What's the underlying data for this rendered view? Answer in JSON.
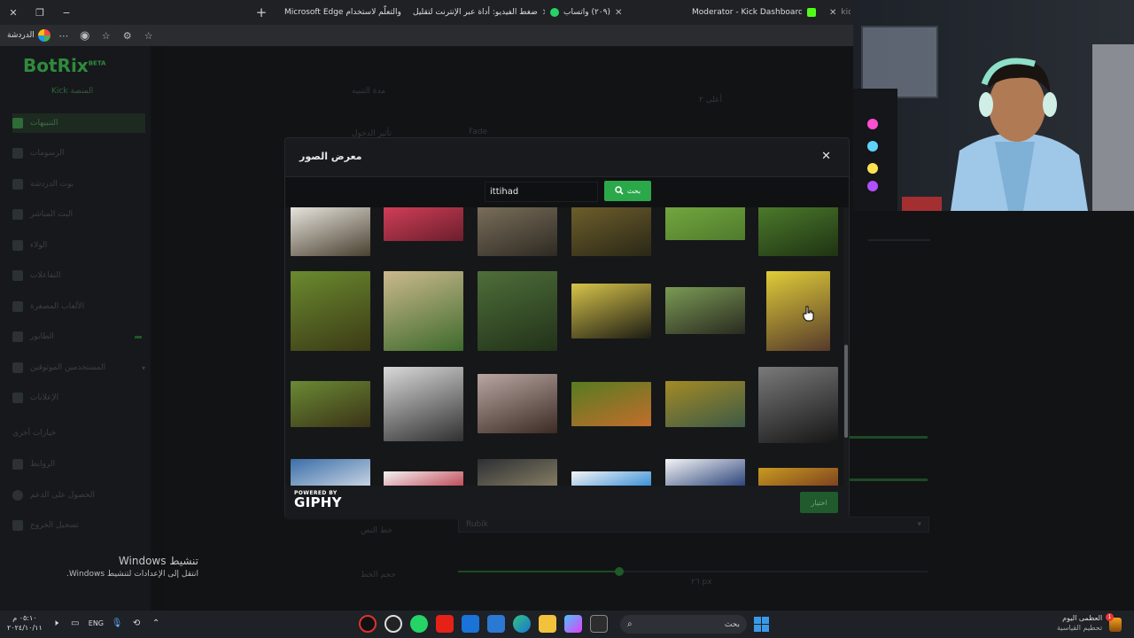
{
  "browser": {
    "tabs": [
      {
        "label": "kick",
        "icon": "kick-favicon-icon",
        "color": "#53fc18"
      },
      {
        "label": "",
        "icon": "kick-favicon-icon",
        "color": "#53fc18"
      },
      {
        "label": "Moderator - Kick Dashboard",
        "icon": "close-icon",
        "color": "#53fc18"
      },
      {
        "label": "(٢٠٩) واتساب",
        "icon": "whatsapp-icon",
        "color": "#25d366"
      },
      {
        "label": "ضغط الفيديو: أداة عبر الإنترنت لتقليل",
        "icon": "compress-icon",
        "color": "#22c55e"
      },
      {
        "label": "المساعدة والتعلّم لاستخدام Microsoft Edge",
        "icon": "microsoft-icon",
        "color": "#f25022"
      }
    ],
    "profile_label": "الدردشة"
  },
  "sidebar": {
    "logo": "BotRix",
    "logo_badge": "BETA",
    "platform_label": "المنصة",
    "platform_value": "Kick",
    "items": [
      {
        "label": "التنبيهات",
        "active": true
      },
      {
        "label": "الرسومات",
        "active": false
      },
      {
        "label": "بوت الدردشة",
        "active": false
      },
      {
        "label": "البث المباشر",
        "active": false
      },
      {
        "label": "الولاء",
        "active": false
      },
      {
        "label": "التفاعلات",
        "active": false
      },
      {
        "label": "الألعاب المصغرة",
        "active": false
      },
      {
        "label": "الطابور",
        "active": false
      },
      {
        "label": "المستخدمين الموثوقين",
        "active": false
      },
      {
        "label": "الإعلانات",
        "active": false
      }
    ],
    "section_title": "خيارات أخرى",
    "other_items": [
      {
        "label": "الروابط"
      },
      {
        "label": "الحصول على الدعم"
      },
      {
        "label": "تسجيل الخروج"
      }
    ]
  },
  "background_form": {
    "label_duration": "مدة التنبيه",
    "field_layout": "أعلى ٢",
    "label_animation": "تأثير الدخول",
    "field_animation": "Fade",
    "label_font": "خط النص",
    "field_font": "Rubik",
    "label_size": "حجم الخط",
    "size_value": "٢٦ px"
  },
  "modal": {
    "title": "معرض الصور",
    "close_symbol": "✕",
    "search_value": "ittihad",
    "search_button": "بحث",
    "powered_by": "POWERED BY",
    "giphy": "GIPHY",
    "choose_button": "اختيار",
    "gifs": [
      {
        "desc": "players celebrating 1",
        "c1": "#e9e7e0",
        "c2": "#4a4030"
      },
      {
        "desc": "red smoke crowd",
        "c1": "#d23f59",
        "c2": "#6b1e2c"
      },
      {
        "desc": "player on field 1",
        "c1": "#7b6f5b",
        "c2": "#2e2a23"
      },
      {
        "desc": "team hug",
        "c1": "#6e5f2c",
        "c2": "#2a2716"
      },
      {
        "desc": "green pitch wide",
        "c1": "#73a83f",
        "c2": "#4f7a2d"
      },
      {
        "desc": "pitch with player",
        "c1": "#4c7b2c",
        "c2": "#1f3313"
      },
      {
        "desc": "players emoji",
        "c1": "#6b8a2f",
        "c2": "#3b3a15"
      },
      {
        "desc": "stadium crowd match",
        "c1": "#cbb98d",
        "c2": "#3e6a2c"
      },
      {
        "desc": "pitch aerial",
        "c1": "#4e6e3a",
        "c2": "#223219"
      },
      {
        "desc": "players embrace yellow",
        "c1": "#d7c34a",
        "c2": "#1c1c14"
      },
      {
        "desc": "players huddle",
        "c1": "#7a9a55",
        "c2": "#2a2a20"
      },
      {
        "desc": "player portrait yellow",
        "c1": "#e0cc38",
        "c2": "#553a2a"
      },
      {
        "desc": "team crowd",
        "c1": "#6a8a34",
        "c2": "#3b3317"
      },
      {
        "desc": "smiling player bw",
        "c1": "#d9d9d9",
        "c2": "#303030"
      },
      {
        "desc": "player crowd celebrate",
        "c1": "#b9a6a3",
        "c2": "#3b2b23"
      },
      {
        "desc": "player orange",
        "c1": "#567c22",
        "c2": "#c36d2b"
      },
      {
        "desc": "stadium celebration",
        "c1": "#a38a25",
        "c2": "#3d5a46"
      },
      {
        "desc": "dark silhouette",
        "c1": "#7a7a7a",
        "c2": "#151515"
      },
      {
        "desc": "stadium blue",
        "c1": "#3a6ea8",
        "c2": "#cfd9e6"
      },
      {
        "desc": "score 3-2",
        "c1": "#f2f2f2",
        "c2": "#b31e2e"
      },
      {
        "desc": "player number 10",
        "c1": "#2c2f33",
        "c2": "#8a8066"
      },
      {
        "desc": "score 2-1",
        "c1": "#f4f4f4",
        "c2": "#2d8ad6"
      },
      {
        "desc": "press conference",
        "c1": "#f5f5f5",
        "c2": "#203a74"
      },
      {
        "desc": "yellow crowd",
        "c1": "#c89b20",
        "c2": "#6b2a20"
      }
    ]
  },
  "activation": {
    "title": "تنشيط Windows",
    "subtitle": "انتقل إلى الإعدادات لتنشيط Windows."
  },
  "taskbar": {
    "time": "٠٥:١٠ م",
    "date": "٢٠٢٤/١٠/١١",
    "lang": "ENG",
    "search_placeholder": "بحث",
    "news_title": "العظمى اليوم",
    "news_sub": "تحطيم القياسية",
    "news_badge": "1"
  }
}
